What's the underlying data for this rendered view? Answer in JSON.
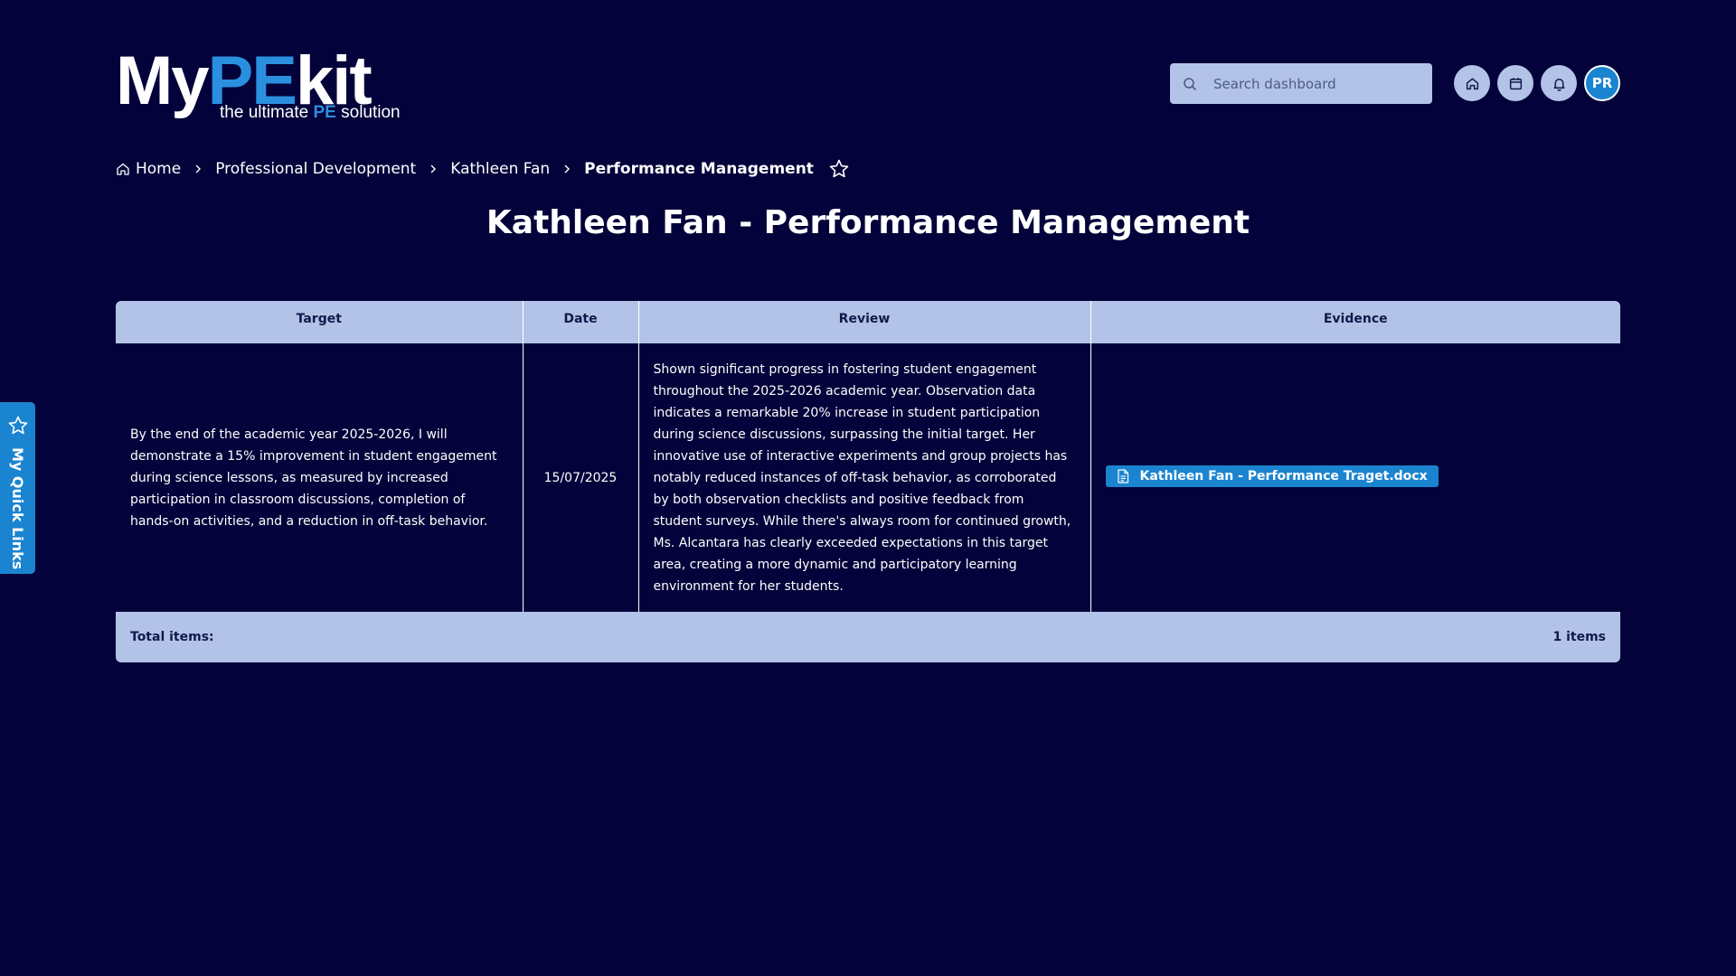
{
  "brand": {
    "logo_part1": "My",
    "logo_part2": "PE",
    "logo_part3": "kit",
    "tagline_pre": "the ultimate ",
    "tagline_highlight": "PE",
    "tagline_post": " solution",
    "accent_color": "#2b8fdf"
  },
  "header": {
    "search_placeholder": "Search dashboard",
    "avatar_initials": "PR",
    "icons": [
      "search-icon",
      "home-icon",
      "calendar-icon",
      "bell-icon"
    ]
  },
  "breadcrumb": {
    "items": [
      "Home",
      "Professional Development",
      "Kathleen Fan"
    ],
    "current": "Performance Management"
  },
  "page": {
    "title": "Kathleen Fan - Performance Management"
  },
  "table": {
    "columns": [
      "Target",
      "Date",
      "Review",
      "Evidence"
    ],
    "rows": [
      {
        "target": "By the end of the academic year 2025-2026, I will demonstrate a 15% improvement in student engagement during science lessons, as measured by increased participation in classroom discussions, completion of hands-on activities, and a reduction in off-task behavior.",
        "date": "15/07/2025",
        "review": "Shown significant progress in fostering student engagement throughout the 2025-2026 academic year. Observation data indicates a remarkable 20% increase in student participation during science discussions, surpassing the initial target. Her innovative use of interactive experiments and group projects has notably reduced instances of off-task behavior, as corroborated by both observation checklists and positive feedback from student surveys. While there's always room for continued growth, Ms. Alcantara has clearly exceeded expectations in this target area, creating a more dynamic and participatory learning environment for her students.",
        "evidence": "Kathleen Fan - Performance Traget.docx"
      }
    ],
    "footer_label": "Total items:",
    "footer_count": "1 items"
  },
  "quick_links": {
    "label": "My Quick Links"
  },
  "colors": {
    "background": "#03023a",
    "panel": "#b3c3e8",
    "primary": "#1a84d0"
  }
}
